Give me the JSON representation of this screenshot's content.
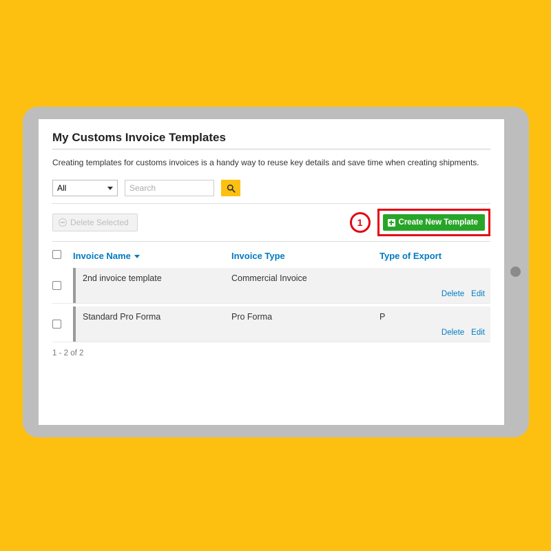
{
  "page": {
    "title": "My Customs Invoice Templates",
    "subtitle": "Creating templates for customs invoices is a handy way to reuse key details and save time when creating shipments."
  },
  "toolbar": {
    "filter_value": "All",
    "search_placeholder": "Search",
    "delete_selected_label": "Delete Selected",
    "create_label": "Create New Template"
  },
  "callout": {
    "number": "1"
  },
  "table": {
    "headers": {
      "name": "Invoice Name",
      "type": "Invoice Type",
      "export": "Type of Export"
    },
    "rows": [
      {
        "name": "2nd invoice template",
        "type": "Commercial Invoice",
        "export": ""
      },
      {
        "name": "Standard Pro Forma",
        "type": "Pro Forma",
        "export": "P"
      }
    ],
    "row_actions": {
      "delete": "Delete",
      "edit": "Edit"
    }
  },
  "paging": {
    "text": "1 - 2 of 2"
  }
}
